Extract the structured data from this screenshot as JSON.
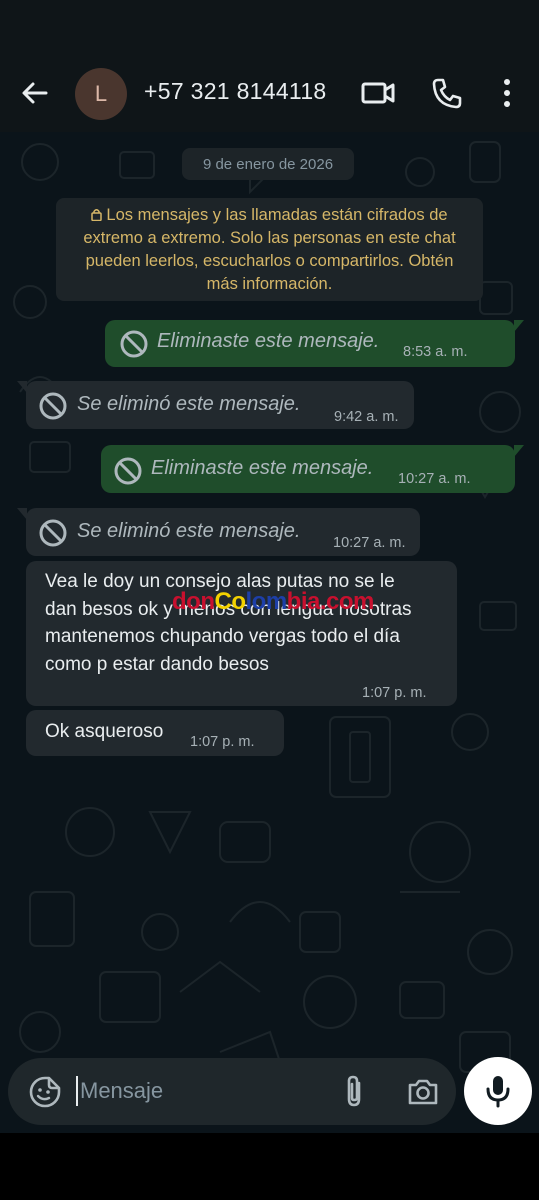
{
  "header": {
    "avatar_initial": "L",
    "contact_name": "+57 321 8144118"
  },
  "chat": {
    "date": "9 de enero de 2026",
    "encryption_notice": "Los mensajes y las llamadas están cifrados de extremo a extremo. Solo las personas en este chat pueden leerlos, escucharlos o compartirlos. Obtén más información.",
    "messages": [
      {
        "direction": "out",
        "deleted": true,
        "text": "Eliminaste este mensaje.",
        "time": "8:53 a. m."
      },
      {
        "direction": "in",
        "deleted": true,
        "text": "Se eliminó este mensaje.",
        "time": "9:42 a. m."
      },
      {
        "direction": "out",
        "deleted": true,
        "text": "Eliminaste este mensaje.",
        "time": "10:27 a. m."
      },
      {
        "direction": "in",
        "deleted": true,
        "text": "Se eliminó este mensaje.",
        "time": "10:27 a. m."
      },
      {
        "direction": "in",
        "deleted": false,
        "text": "Vea le doy un consejo alas putas no se le dan besos ok y menos con lengua nosotras mantenemos chupando vergas todo el día como p estar dando besos",
        "time": "1:07 p. m."
      },
      {
        "direction": "in",
        "deleted": false,
        "text": "Ok asqueroso",
        "time": "1:07 p. m."
      }
    ],
    "watermark": {
      "part1": "don",
      "part2": "Co",
      "part3": "lom",
      "part4": "bia.com"
    }
  },
  "input": {
    "placeholder": "Mensaje"
  },
  "colors": {
    "outgoing_bubble": "#1f4d2b",
    "incoming_bubble": "#22292e",
    "notice_text": "#d6b768",
    "background": "#0b141a"
  }
}
